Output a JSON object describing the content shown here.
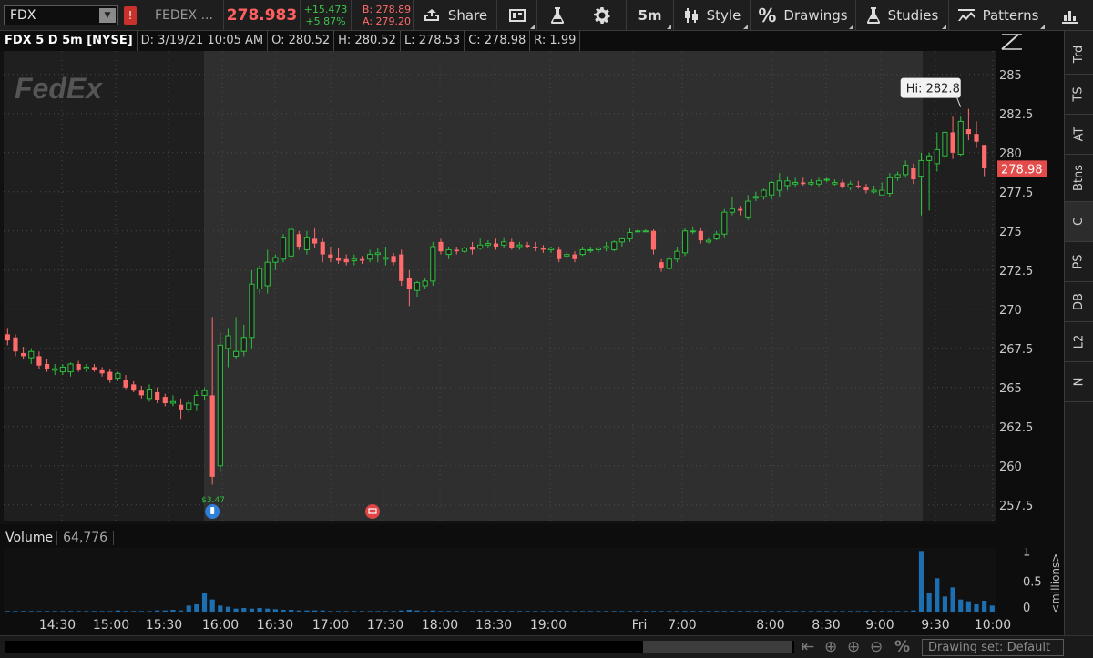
{
  "toolbar": {
    "symbol": "FDX",
    "alert_label": "!",
    "description": "FEDEX ...",
    "last_price": "278.983",
    "net_change": "+15.473",
    "pct_change": "+5.87%",
    "bid": "B: 278.89",
    "ask": "A: 279.20",
    "share_label": "Share",
    "aggregation": "5m",
    "style_label": "Style",
    "drawings_label": "Drawings",
    "studies_label": "Studies",
    "patterns_label": "Patterns"
  },
  "header": {
    "title": "FDX 5 D 5m [NYSE]",
    "date": "D: 3/19/21 10:05 AM",
    "open": "O: 280.52",
    "high": "H: 280.52",
    "low": "L: 278.53",
    "close": "C: 278.98",
    "range": "R: 1.99"
  },
  "sidebar": {
    "tabs": [
      "Trd",
      "TS",
      "AT",
      "Btns",
      "C",
      "PS",
      "DB",
      "L2",
      "N"
    ]
  },
  "volume": {
    "label": "Volume",
    "value": "64,776",
    "unit_label": "<millions>"
  },
  "bottom": {
    "drawing_set": "Drawing set: Default"
  },
  "colors": {
    "up": "#2fbe3d",
    "down": "#ff6b6b",
    "background_premarket": "#1f1f1f",
    "background_session": "#2f2f2f",
    "volume_bar": "#1c6fb0",
    "price_label_bg": "#e44b4b"
  },
  "chart_data": {
    "type": "candlestick",
    "symbol": "FDX",
    "interval": "5m",
    "ylim": [
      256.5,
      286.5
    ],
    "y_ticks": [
      285,
      282.5,
      280,
      277.5,
      275,
      272.5,
      270,
      267.5,
      265,
      262.5,
      260,
      257.5
    ],
    "x_tick_labels": [
      "14:30",
      "15:00",
      "15:30",
      "16:00",
      "16:30",
      "17:00",
      "17:30",
      "18:00",
      "18:30",
      "19:00",
      "Fri",
      "7:00",
      "8:00",
      "8:30",
      "9:00",
      "9:30",
      "10:00"
    ],
    "last_price_label": "278.98",
    "high_annotation": "Hi: 282.8",
    "earnings_annotation": "$3.47",
    "watermark": "FedEx",
    "candles": [
      {
        "o": 268.4,
        "h": 268.8,
        "l": 267.7,
        "c": 268.0
      },
      {
        "o": 268.2,
        "h": 268.4,
        "l": 267.0,
        "c": 267.3
      },
      {
        "o": 267.2,
        "h": 267.6,
        "l": 266.8,
        "c": 267.0
      },
      {
        "o": 266.9,
        "h": 267.5,
        "l": 266.5,
        "c": 267.3
      },
      {
        "o": 267.0,
        "h": 267.3,
        "l": 266.2,
        "c": 266.4
      },
      {
        "o": 266.5,
        "h": 266.8,
        "l": 266.0,
        "c": 266.2
      },
      {
        "o": 266.1,
        "h": 266.5,
        "l": 265.8,
        "c": 266.2
      },
      {
        "o": 266.0,
        "h": 266.5,
        "l": 265.8,
        "c": 266.3
      },
      {
        "o": 266.0,
        "h": 266.6,
        "l": 265.7,
        "c": 266.5
      },
      {
        "o": 266.5,
        "h": 266.7,
        "l": 266.0,
        "c": 266.1
      },
      {
        "o": 266.2,
        "h": 266.5,
        "l": 266.0,
        "c": 266.3
      },
      {
        "o": 266.3,
        "h": 266.5,
        "l": 266.0,
        "c": 266.1
      },
      {
        "o": 266.1,
        "h": 266.3,
        "l": 265.7,
        "c": 265.9
      },
      {
        "o": 266.0,
        "h": 266.2,
        "l": 265.3,
        "c": 265.5
      },
      {
        "o": 265.6,
        "h": 266.0,
        "l": 265.4,
        "c": 265.9
      },
      {
        "o": 265.5,
        "h": 265.8,
        "l": 264.9,
        "c": 265.0
      },
      {
        "o": 265.2,
        "h": 265.4,
        "l": 264.7,
        "c": 264.8
      },
      {
        "o": 264.8,
        "h": 265.1,
        "l": 264.3,
        "c": 264.5
      },
      {
        "o": 264.3,
        "h": 265.2,
        "l": 264.1,
        "c": 264.9
      },
      {
        "o": 264.7,
        "h": 265.0,
        "l": 264.0,
        "c": 264.2
      },
      {
        "o": 264.4,
        "h": 264.6,
        "l": 263.8,
        "c": 264.0
      },
      {
        "o": 264.0,
        "h": 264.5,
        "l": 263.8,
        "c": 264.1
      },
      {
        "o": 263.9,
        "h": 264.3,
        "l": 263.0,
        "c": 263.6
      },
      {
        "o": 263.6,
        "h": 264.2,
        "l": 263.4,
        "c": 264.0
      },
      {
        "o": 263.9,
        "h": 264.8,
        "l": 263.5,
        "c": 264.5
      },
      {
        "o": 264.5,
        "h": 265.0,
        "l": 264.2,
        "c": 264.8
      },
      {
        "o": 264.5,
        "h": 269.5,
        "l": 258.8,
        "c": 259.3
      },
      {
        "o": 260.0,
        "h": 268.5,
        "l": 259.6,
        "c": 267.7
      },
      {
        "o": 267.5,
        "h": 268.8,
        "l": 266.3,
        "c": 268.3
      },
      {
        "o": 267.0,
        "h": 269.5,
        "l": 266.8,
        "c": 267.3
      },
      {
        "o": 267.3,
        "h": 269.0,
        "l": 267.0,
        "c": 268.2
      },
      {
        "o": 268.2,
        "h": 272.5,
        "l": 267.5,
        "c": 271.6
      },
      {
        "o": 271.3,
        "h": 272.8,
        "l": 271.0,
        "c": 272.6
      },
      {
        "o": 271.5,
        "h": 273.8,
        "l": 271.0,
        "c": 273.0
      },
      {
        "o": 273.0,
        "h": 273.5,
        "l": 272.5,
        "c": 273.3
      },
      {
        "o": 273.2,
        "h": 274.8,
        "l": 273.0,
        "c": 274.6
      },
      {
        "o": 273.4,
        "h": 275.3,
        "l": 273.0,
        "c": 275.1
      },
      {
        "o": 274.8,
        "h": 275.0,
        "l": 273.8,
        "c": 274.0
      },
      {
        "o": 273.8,
        "h": 275.0,
        "l": 273.5,
        "c": 274.6
      },
      {
        "o": 274.5,
        "h": 275.2,
        "l": 273.9,
        "c": 274.2
      },
      {
        "o": 274.3,
        "h": 274.5,
        "l": 273.0,
        "c": 273.5
      },
      {
        "o": 273.5,
        "h": 274.0,
        "l": 273.0,
        "c": 273.3
      },
      {
        "o": 273.3,
        "h": 273.9,
        "l": 272.9,
        "c": 273.1
      },
      {
        "o": 273.2,
        "h": 273.5,
        "l": 272.8,
        "c": 273.0
      },
      {
        "o": 273.1,
        "h": 273.5,
        "l": 272.8,
        "c": 273.2
      },
      {
        "o": 273.2,
        "h": 273.4,
        "l": 272.9,
        "c": 273.1
      },
      {
        "o": 273.2,
        "h": 273.8,
        "l": 273.0,
        "c": 273.5
      },
      {
        "o": 273.5,
        "h": 273.9,
        "l": 273.0,
        "c": 273.6
      },
      {
        "o": 273.2,
        "h": 274.0,
        "l": 272.8,
        "c": 273.3
      },
      {
        "o": 273.4,
        "h": 273.6,
        "l": 272.8,
        "c": 273.0
      },
      {
        "o": 273.5,
        "h": 273.8,
        "l": 271.5,
        "c": 271.8
      },
      {
        "o": 272.0,
        "h": 272.5,
        "l": 270.2,
        "c": 271.3
      },
      {
        "o": 271.2,
        "h": 271.8,
        "l": 270.8,
        "c": 271.7
      },
      {
        "o": 271.5,
        "h": 272.0,
        "l": 271.3,
        "c": 271.8
      },
      {
        "o": 271.8,
        "h": 274.3,
        "l": 271.5,
        "c": 274.0
      },
      {
        "o": 274.3,
        "h": 274.5,
        "l": 273.5,
        "c": 273.7
      },
      {
        "o": 273.5,
        "h": 274.0,
        "l": 273.2,
        "c": 273.8
      },
      {
        "o": 273.8,
        "h": 274.0,
        "l": 273.5,
        "c": 273.7
      },
      {
        "o": 273.7,
        "h": 274.0,
        "l": 273.6,
        "c": 273.9
      },
      {
        "o": 274.0,
        "h": 274.3,
        "l": 273.5,
        "c": 273.8
      },
      {
        "o": 273.9,
        "h": 274.5,
        "l": 273.8,
        "c": 274.1
      },
      {
        "o": 274.1,
        "h": 274.4,
        "l": 273.9,
        "c": 274.2
      },
      {
        "o": 274.2,
        "h": 274.5,
        "l": 273.8,
        "c": 274.0
      },
      {
        "o": 274.1,
        "h": 274.6,
        "l": 273.9,
        "c": 274.3
      },
      {
        "o": 274.3,
        "h": 274.5,
        "l": 273.8,
        "c": 273.9
      },
      {
        "o": 274.0,
        "h": 274.3,
        "l": 273.8,
        "c": 274.1
      },
      {
        "o": 274.1,
        "h": 274.3,
        "l": 273.9,
        "c": 274.0
      },
      {
        "o": 274.0,
        "h": 274.3,
        "l": 273.7,
        "c": 273.9
      },
      {
        "o": 273.9,
        "h": 274.1,
        "l": 273.6,
        "c": 273.8
      },
      {
        "o": 273.8,
        "h": 274.0,
        "l": 273.6,
        "c": 273.9
      },
      {
        "o": 273.8,
        "h": 274.0,
        "l": 273.0,
        "c": 273.2
      },
      {
        "o": 273.4,
        "h": 273.7,
        "l": 273.2,
        "c": 273.5
      },
      {
        "o": 273.5,
        "h": 273.7,
        "l": 273.0,
        "c": 273.2
      },
      {
        "o": 273.5,
        "h": 274.0,
        "l": 273.4,
        "c": 273.8
      },
      {
        "o": 273.8,
        "h": 274.0,
        "l": 273.6,
        "c": 273.8
      },
      {
        "o": 273.8,
        "h": 274.0,
        "l": 273.6,
        "c": 273.9
      },
      {
        "o": 273.9,
        "h": 274.3,
        "l": 273.7,
        "c": 274.0
      },
      {
        "o": 273.8,
        "h": 274.4,
        "l": 273.7,
        "c": 274.3
      },
      {
        "o": 274.3,
        "h": 274.6,
        "l": 274.0,
        "c": 274.5
      },
      {
        "o": 274.5,
        "h": 275.2,
        "l": 274.3,
        "c": 274.9
      },
      {
        "o": 275.0,
        "h": 275.1,
        "l": 275.0,
        "c": 275.0
      },
      {
        "o": 275.0,
        "h": 275.1,
        "l": 275.0,
        "c": 275.0
      },
      {
        "o": 275.0,
        "h": 275.1,
        "l": 273.5,
        "c": 273.8
      },
      {
        "o": 273.0,
        "h": 273.2,
        "l": 272.4,
        "c": 272.6
      },
      {
        "o": 272.6,
        "h": 273.4,
        "l": 272.5,
        "c": 273.2
      },
      {
        "o": 273.2,
        "h": 274.0,
        "l": 273.0,
        "c": 273.7
      },
      {
        "o": 273.6,
        "h": 275.2,
        "l": 273.4,
        "c": 275.0
      },
      {
        "o": 275.0,
        "h": 275.3,
        "l": 274.8,
        "c": 275.0
      },
      {
        "o": 275.0,
        "h": 275.2,
        "l": 274.2,
        "c": 274.4
      },
      {
        "o": 274.3,
        "h": 274.6,
        "l": 274.2,
        "c": 274.4
      },
      {
        "o": 274.5,
        "h": 275.0,
        "l": 274.4,
        "c": 274.8
      },
      {
        "o": 274.8,
        "h": 276.4,
        "l": 274.6,
        "c": 276.2
      },
      {
        "o": 276.2,
        "h": 277.2,
        "l": 276.0,
        "c": 276.4
      },
      {
        "o": 276.4,
        "h": 276.6,
        "l": 276.0,
        "c": 276.3
      },
      {
        "o": 275.9,
        "h": 277.3,
        "l": 275.7,
        "c": 276.9
      },
      {
        "o": 277.1,
        "h": 277.5,
        "l": 276.9,
        "c": 277.2
      },
      {
        "o": 277.2,
        "h": 277.7,
        "l": 277.0,
        "c": 277.6
      },
      {
        "o": 277.3,
        "h": 278.2,
        "l": 277.0,
        "c": 278.1
      },
      {
        "o": 277.6,
        "h": 278.7,
        "l": 277.2,
        "c": 278.2
      },
      {
        "o": 277.9,
        "h": 278.5,
        "l": 277.6,
        "c": 278.2
      },
      {
        "o": 278.0,
        "h": 278.4,
        "l": 277.8,
        "c": 278.1
      },
      {
        "o": 278.1,
        "h": 278.4,
        "l": 277.9,
        "c": 278.0
      },
      {
        "o": 278.0,
        "h": 278.3,
        "l": 277.9,
        "c": 278.1
      },
      {
        "o": 278.0,
        "h": 278.4,
        "l": 277.8,
        "c": 278.2
      },
      {
        "o": 278.3,
        "h": 278.4,
        "l": 278.1,
        "c": 278.3
      },
      {
        "o": 278.0,
        "h": 278.3,
        "l": 277.9,
        "c": 278.1
      },
      {
        "o": 278.1,
        "h": 278.3,
        "l": 277.7,
        "c": 277.8
      },
      {
        "o": 277.8,
        "h": 278.2,
        "l": 277.6,
        "c": 278.0
      },
      {
        "o": 277.9,
        "h": 278.2,
        "l": 277.7,
        "c": 277.8
      },
      {
        "o": 277.8,
        "h": 278.0,
        "l": 277.4,
        "c": 277.6
      },
      {
        "o": 277.5,
        "h": 277.9,
        "l": 277.4,
        "c": 277.6
      },
      {
        "o": 277.3,
        "h": 278.1,
        "l": 277.3,
        "c": 277.6
      },
      {
        "o": 277.4,
        "h": 278.7,
        "l": 277.2,
        "c": 278.4
      },
      {
        "o": 278.4,
        "h": 278.8,
        "l": 278.2,
        "c": 278.6
      },
      {
        "o": 278.6,
        "h": 279.5,
        "l": 278.4,
        "c": 279.2
      },
      {
        "o": 279.0,
        "h": 279.3,
        "l": 278.0,
        "c": 278.3
      },
      {
        "o": 278.5,
        "h": 280.0,
        "l": 276.0,
        "c": 279.5
      },
      {
        "o": 279.5,
        "h": 280.0,
        "l": 276.3,
        "c": 279.8
      },
      {
        "o": 279.3,
        "h": 281.3,
        "l": 278.8,
        "c": 280.2
      },
      {
        "o": 279.8,
        "h": 281.5,
        "l": 279.5,
        "c": 281.3
      },
      {
        "o": 281.3,
        "h": 282.3,
        "l": 279.6,
        "c": 280.0
      },
      {
        "o": 279.9,
        "h": 282.3,
        "l": 279.8,
        "c": 282.0
      },
      {
        "o": 281.5,
        "h": 282.8,
        "l": 280.8,
        "c": 281.2
      },
      {
        "o": 281.2,
        "h": 282.0,
        "l": 280.3,
        "c": 280.7
      },
      {
        "o": 280.5,
        "h": 280.5,
        "l": 278.5,
        "c": 279.0
      }
    ],
    "volume_ylim": [
      0,
      1.05
    ],
    "volume_ticks": [
      1,
      0.5,
      0
    ],
    "volume": [
      0.01,
      0.01,
      0.01,
      0.01,
      0.01,
      0.01,
      0.01,
      0.01,
      0.01,
      0.01,
      0.01,
      0.01,
      0.01,
      0.01,
      0.02,
      0.01,
      0.01,
      0.01,
      0.01,
      0.02,
      0.02,
      0.03,
      0.02,
      0.1,
      0.12,
      0.3,
      0.2,
      0.1,
      0.08,
      0.05,
      0.06,
      0.05,
      0.06,
      0.05,
      0.04,
      0.03,
      0.03,
      0.02,
      0.02,
      0.02,
      0.02,
      0.01,
      0.01,
      0.01,
      0.01,
      0.01,
      0.01,
      0.01,
      0.01,
      0.01,
      0.02,
      0.03,
      0.02,
      0.01,
      0.02,
      0.01,
      0.01,
      0.01,
      0.01,
      0.01,
      0.01,
      0.01,
      0.01,
      0.01,
      0.01,
      0.01,
      0.01,
      0.01,
      0.01,
      0.01,
      0.01,
      0.01,
      0.01,
      0.01,
      0.01,
      0.01,
      0.01,
      0.01,
      0.01,
      0.01,
      0.01,
      0.01,
      0.01,
      0.01,
      0.01,
      0.01,
      0.01,
      0.01,
      0.01,
      0.01,
      0.01,
      0.01,
      0.01,
      0.01,
      0.01,
      0.01,
      0.01,
      0.01,
      0.01,
      0.01,
      0.01,
      0.01,
      0.01,
      0.01,
      0.01,
      0.01,
      0.01,
      0.01,
      0.01,
      0.01,
      0.01,
      0.01,
      0.01,
      0.01,
      0.01,
      0.02,
      1.0,
      0.3,
      0.55,
      0.25,
      0.4,
      0.2,
      0.17,
      0.12,
      0.18,
      0.1,
      0.08
    ]
  }
}
